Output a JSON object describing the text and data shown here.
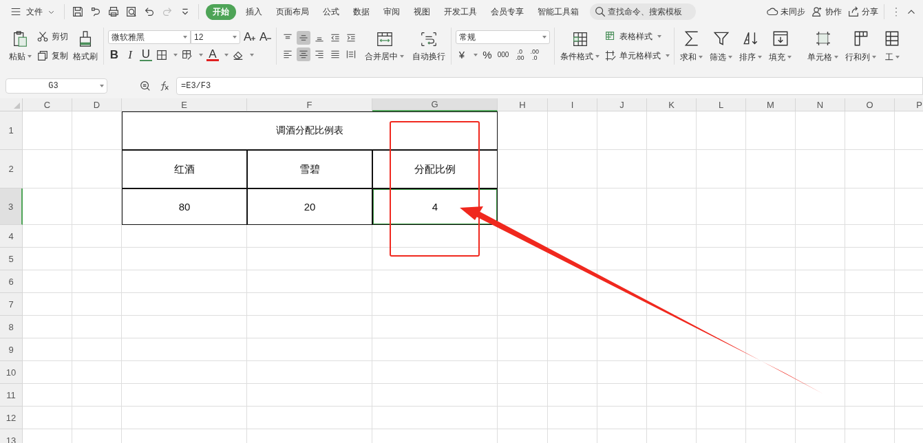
{
  "menu_bar": {
    "file_menu": "文件",
    "quick_access": [
      {
        "kind": "save",
        "disabled": false
      },
      {
        "kind": "export",
        "disabled": false
      },
      {
        "kind": "print",
        "disabled": false
      },
      {
        "kind": "preview",
        "disabled": false
      },
      {
        "kind": "undo",
        "disabled": false
      },
      {
        "kind": "redo",
        "disabled": true
      },
      {
        "kind": "customize",
        "disabled": false
      }
    ],
    "tabs": [
      {
        "label": "开始",
        "selected": true
      },
      {
        "label": "插入",
        "selected": false
      },
      {
        "label": "页面布局",
        "selected": false
      },
      {
        "label": "公式",
        "selected": false
      },
      {
        "label": "数据",
        "selected": false
      },
      {
        "label": "审阅",
        "selected": false
      },
      {
        "label": "视图",
        "selected": false
      },
      {
        "label": "开发工具",
        "selected": false
      },
      {
        "label": "会员专享",
        "selected": false
      },
      {
        "label": "智能工具箱",
        "selected": false
      }
    ],
    "search": {
      "placeholder": "查找命令、搜索模板"
    },
    "actions": [
      {
        "kind": "sync",
        "label": "未同步"
      },
      {
        "kind": "collab",
        "label": "协作"
      },
      {
        "kind": "share",
        "label": "分享"
      }
    ]
  },
  "ribbon": {
    "clipboard": {
      "paste": "粘贴",
      "cut": "剪切",
      "copy": "复制",
      "format_painter": "格式刷"
    },
    "font": {
      "name": "微软雅黑",
      "size": "12",
      "size_buttons": [
        {
          "kind": "grow",
          "glyph": "A"
        },
        {
          "kind": "shrink",
          "glyph": "A"
        }
      ],
      "style_buttons": [
        {
          "kind": "bold",
          "glyph": "B"
        },
        {
          "kind": "italic",
          "glyph": "I"
        },
        {
          "kind": "underline",
          "glyph": "U"
        },
        {
          "kind": "border"
        },
        {
          "kind": "fill"
        },
        {
          "kind": "font-color",
          "glyph": "A"
        },
        {
          "kind": "clear"
        }
      ]
    },
    "alignment": {
      "buttons": [
        {
          "kind": "top",
          "selected": false
        },
        {
          "kind": "middle",
          "selected": true
        },
        {
          "kind": "bottom",
          "selected": false
        },
        {
          "kind": "outdent",
          "selected": false
        },
        {
          "kind": "indent",
          "selected": false
        },
        {
          "kind": "left",
          "selected": false
        },
        {
          "kind": "center",
          "selected": true
        },
        {
          "kind": "right",
          "selected": false
        },
        {
          "kind": "justify",
          "selected": false
        },
        {
          "kind": "distributed",
          "selected": false
        }
      ],
      "merge": "合并居中",
      "wrap": "自动换行"
    },
    "number": {
      "format": "常规",
      "buttons": [
        {
          "kind": "currency",
          "glyph": "¥"
        },
        {
          "kind": "percent",
          "glyph": "%"
        },
        {
          "kind": "thousands",
          "glyph": "000"
        },
        {
          "kind": "add-decimal",
          "top": ".0",
          "bottom": ".00"
        },
        {
          "kind": "remove-decimal",
          "top": ".00",
          "bottom": ".0"
        }
      ]
    },
    "styles": {
      "conditional": "条件格式",
      "table_style": "表格样式",
      "cell_style": "单元格样式"
    },
    "editing": [
      {
        "kind": "sum",
        "label": "求和"
      },
      {
        "kind": "filter",
        "label": "筛选"
      },
      {
        "kind": "sort",
        "label": "排序"
      },
      {
        "kind": "fill",
        "label": "填充"
      },
      {
        "kind": "cell",
        "label": "单元格"
      },
      {
        "kind": "rowcol",
        "label": "行和列"
      },
      {
        "kind": "sheet",
        "label": "工"
      }
    ]
  },
  "formula_bar": {
    "name_box": "G3",
    "formula": "=E3/F3"
  },
  "sheet": {
    "columns": [
      {
        "label": "C",
        "selected": false
      },
      {
        "label": "D",
        "selected": false
      },
      {
        "label": "E",
        "selected": false
      },
      {
        "label": "F",
        "selected": false
      },
      {
        "label": "G",
        "selected": true
      },
      {
        "label": "H",
        "selected": false
      },
      {
        "label": "I",
        "selected": false
      },
      {
        "label": "J",
        "selected": false
      },
      {
        "label": "K",
        "selected": false
      },
      {
        "label": "L",
        "selected": false
      },
      {
        "label": "M",
        "selected": false
      },
      {
        "label": "N",
        "selected": false
      },
      {
        "label": "O",
        "selected": false
      },
      {
        "label": "P",
        "selected": false
      }
    ],
    "rows": [
      {
        "label": "1",
        "selected": false
      },
      {
        "label": "2",
        "selected": false
      },
      {
        "label": "3",
        "selected": true
      },
      {
        "label": "4",
        "selected": false
      },
      {
        "label": "5",
        "selected": false
      },
      {
        "label": "6",
        "selected": false
      },
      {
        "label": "7",
        "selected": false
      },
      {
        "label": "8",
        "selected": false
      },
      {
        "label": "9",
        "selected": false
      },
      {
        "label": "10",
        "selected": false
      },
      {
        "label": "11",
        "selected": false
      },
      {
        "label": "12",
        "selected": false
      },
      {
        "label": "13",
        "selected": false
      }
    ],
    "table": {
      "title": "调酒分配比例表",
      "headers": [
        "红酒",
        "雪碧",
        "分配比例"
      ],
      "rows": [
        [
          {
            "text": "80",
            "selected": false
          },
          {
            "text": "20",
            "selected": false
          },
          {
            "text": "4",
            "selected": true
          }
        ]
      ]
    }
  }
}
